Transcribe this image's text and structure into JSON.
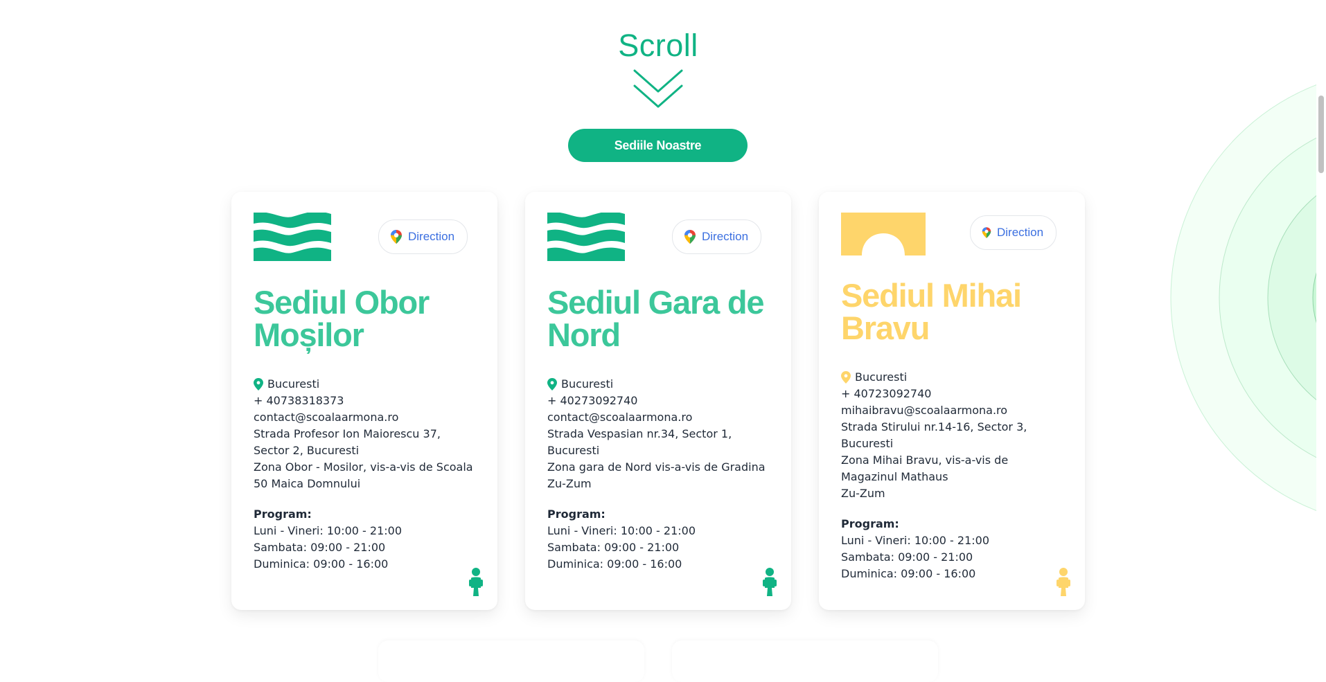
{
  "hero": {
    "scroll_label": "Scroll",
    "cta_label": "Sediile Noastre"
  },
  "colors": {
    "green": "#10b384",
    "green_title": "#3cc79a",
    "yellow": "#fed56b",
    "link_blue": "#3b6fe0"
  },
  "cards": [
    {
      "direction_label": "Direction",
      "title": "Sediul Obor Moșilor",
      "city": "Bucuresti",
      "phone": "+ 40738318373",
      "email": "contact@scoalaarmona.ro",
      "address": "Strada Profesor Ion Maiorescu 37, Sector 2, Bucuresti",
      "zone": "Zona Obor - Mosilor, vis-a-vis de Scoala 50 Maica Domnului",
      "program_title": "Program:",
      "program_weekdays": "Luni - Vineri: 10:00 - 21:00",
      "program_saturday": "Sambata: 09:00 - 21:00",
      "program_sunday": "Duminica: 09:00 - 16:00",
      "logo_icon": "waves-logo-icon",
      "accent": "green"
    },
    {
      "direction_label": "Direction",
      "title": "Sediul Gara de Nord",
      "city": "Bucuresti",
      "phone": "+ 40273092740",
      "email": "contact@scoalaarmona.ro",
      "address": "Strada Vespasian nr.34, Sector 1, Bucuresti",
      "zone": "Zona gara de Nord vis-a-vis de Gradina\nZu-Zum",
      "program_title": "Program:",
      "program_weekdays": "Luni - Vineri: 10:00 - 21:00",
      "program_saturday": "Sambata: 09:00 - 21:00",
      "program_sunday": "Duminica: 09:00 - 16:00",
      "logo_icon": "waves-logo-icon",
      "accent": "green"
    },
    {
      "direction_label": "Direction",
      "title": "Sediul Mihai Bravu",
      "city": "Bucuresti",
      "phone": "+ 40723092740",
      "email": "mihaibravu@scoalaarmona.ro",
      "address": "Strada Stirului nr.14-16, Sector 3, Bucuresti",
      "zone": "Zona Mihai Bravu, vis-a-vis de Magazinul Mathaus\nZu-Zum",
      "program_title": "Program:",
      "program_weekdays": "Luni - Vineri: 10:00 - 21:00",
      "program_saturday": "Sambata: 09:00 - 21:00",
      "program_sunday": "Duminica: 09:00 - 16:00",
      "logo_icon": "arch-logo-icon",
      "accent": "yellow"
    }
  ]
}
